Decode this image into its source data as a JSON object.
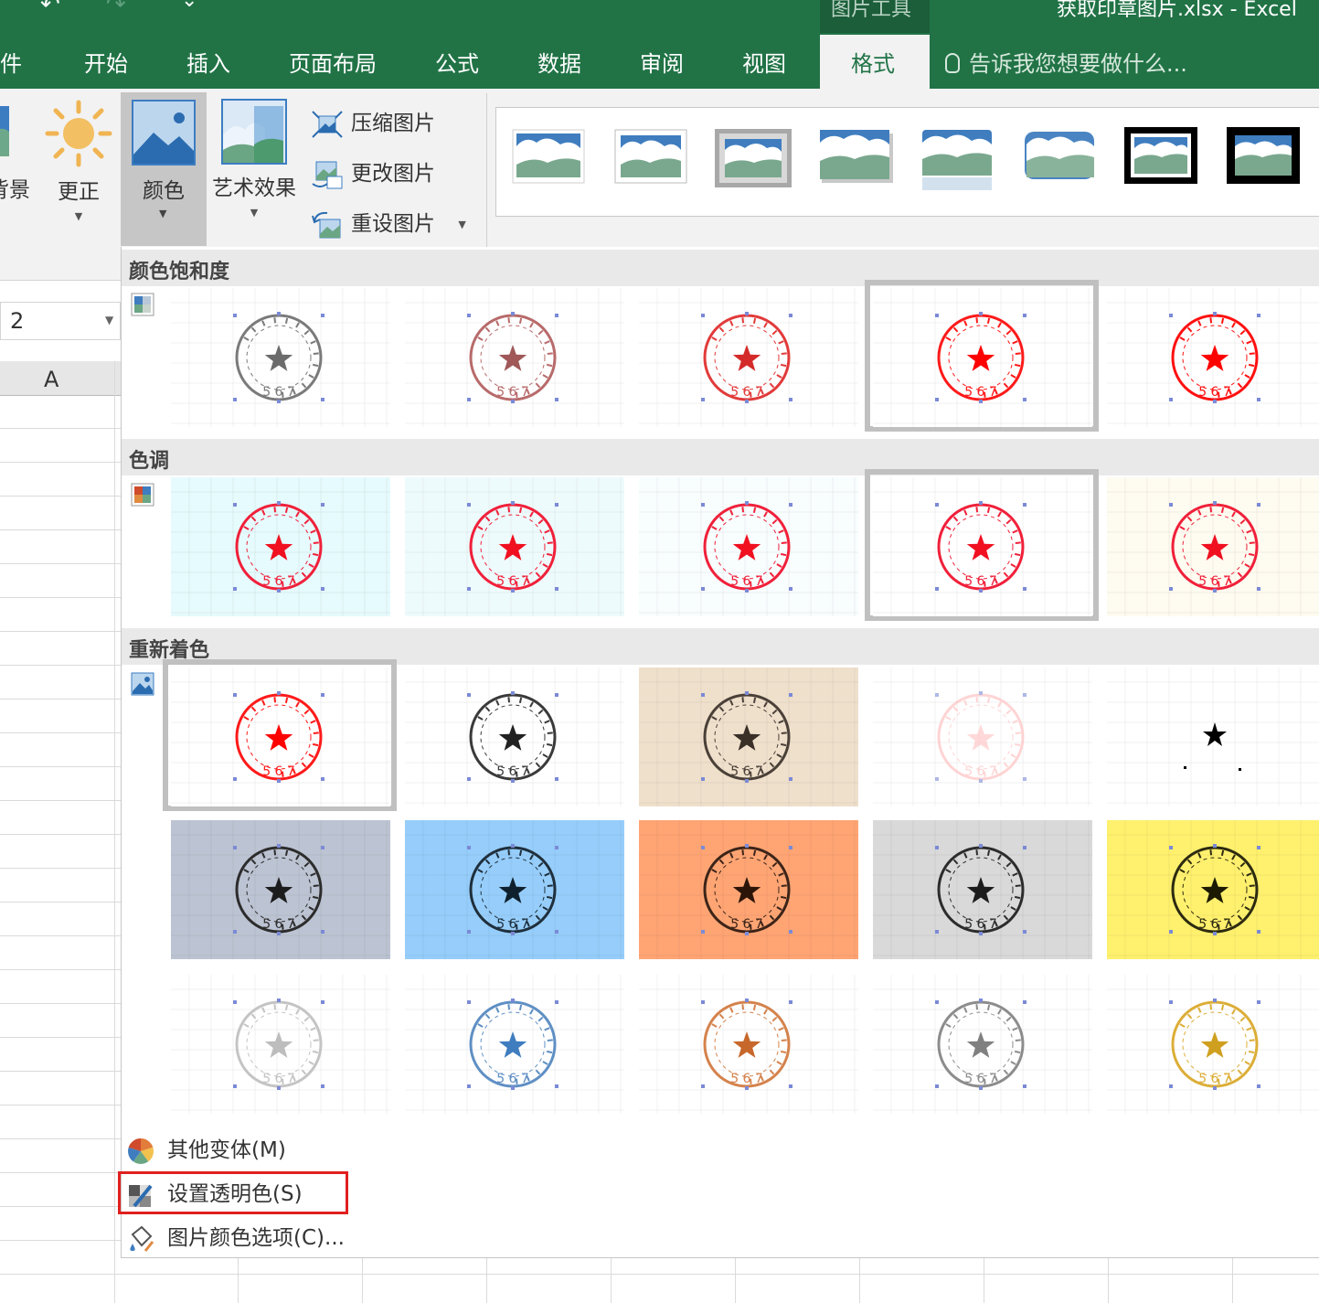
{
  "title_bar": {
    "context_group": "图片工具",
    "document_title": "获取印章图片.xlsx  -  Excel"
  },
  "tabs": {
    "file": "件",
    "home": "开始",
    "insert": "插入",
    "page_layout": "页面布局",
    "formulas": "公式",
    "data": "数据",
    "review": "审阅",
    "view": "视图",
    "format": "格式"
  },
  "tell_me": "告诉我您想要做什么...",
  "ribbon": {
    "background_label": "背景",
    "corrections_label": "更正",
    "color_label": "颜色",
    "artistic_label": "艺术效果",
    "compress_label": "压缩图片",
    "change_label": "更改图片",
    "reset_label": "重设图片"
  },
  "sheet": {
    "name_box": "2",
    "column_a": "A"
  },
  "dropdown": {
    "saturation_header": "颜色饱和度",
    "tone_header": "色调",
    "recolor_header": "重新着色",
    "more_variations": "其他变体(M)",
    "set_transparent": "设置透明色(S)",
    "picture_color_options": "图片颜色选项(C)...",
    "stamp_digits": "5 6 7"
  },
  "colors": {
    "excel_green": "#217346",
    "highlight_red": "#e02020",
    "selected_border": "#c0c0c0"
  }
}
